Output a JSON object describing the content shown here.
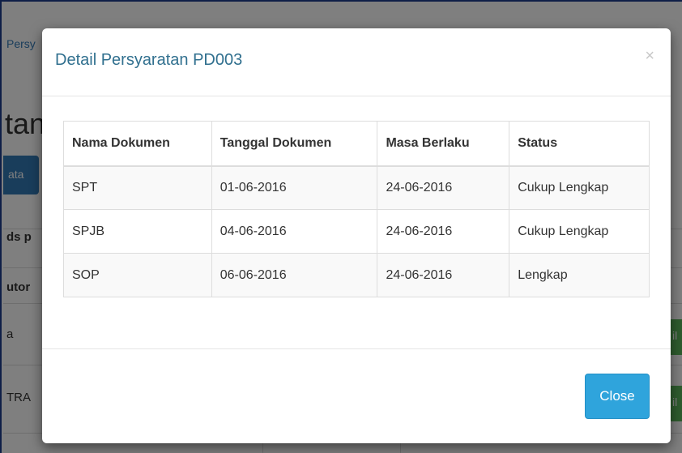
{
  "background": {
    "breadcrumb": "Persy",
    "heading": "tan",
    "primary_button": "ata",
    "label_1": "ds p",
    "label_2": "utor",
    "row_1": "a",
    "row_2": "TRA",
    "green_button_1": "il",
    "green_button_2": "il"
  },
  "modal": {
    "title": "Detail Persyaratan PD003",
    "close_icon": "×",
    "table": {
      "headers": [
        "Nama Dokumen",
        "Tanggal Dokumen",
        "Masa Berlaku",
        "Status"
      ],
      "rows": [
        [
          "SPT",
          "01-06-2016",
          "24-06-2016",
          "Cukup Lengkap"
        ],
        [
          "SPJB",
          "04-06-2016",
          "24-06-2016",
          "Cukup Lengkap"
        ],
        [
          "SOP",
          "06-06-2016",
          "24-06-2016",
          "Lengkap"
        ]
      ]
    },
    "close_button": "Close"
  },
  "colors": {
    "title": "#31708f",
    "close_button": "#2fa4dc",
    "primary": "#337ab7",
    "success": "#5cb85c"
  }
}
